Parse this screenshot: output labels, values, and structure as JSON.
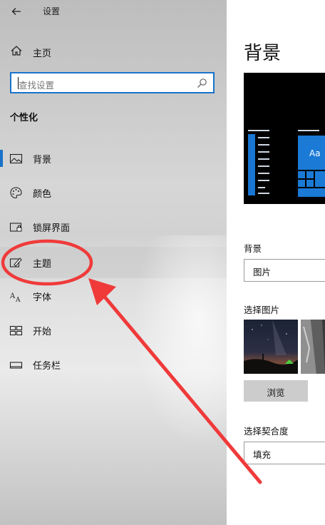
{
  "app": {
    "title": "设置"
  },
  "nav": {
    "home_label": "主页",
    "search_placeholder": "查找设置",
    "section_title": "个性化",
    "items": [
      {
        "label": "背景",
        "icon": "image-icon",
        "selected": true
      },
      {
        "label": "颜色",
        "icon": "palette-icon"
      },
      {
        "label": "锁屏界面",
        "icon": "lock-screen-icon"
      },
      {
        "label": "主题",
        "icon": "theme-brush-icon",
        "highlighted": true
      },
      {
        "label": "字体",
        "icon": "font-icon"
      },
      {
        "label": "开始",
        "icon": "start-tiles-icon"
      },
      {
        "label": "任务栏",
        "icon": "taskbar-icon"
      }
    ]
  },
  "main": {
    "title": "背景",
    "preview": {
      "tile_text": "Aa"
    },
    "background_label": "背景",
    "background_value": "图片",
    "choose_picture_label": "选择图片",
    "browse_label": "浏览",
    "fit_label": "选择契合度",
    "fit_value": "填充"
  },
  "colors": {
    "accent": "#1a73c9",
    "annotation": "#f03a3a"
  }
}
